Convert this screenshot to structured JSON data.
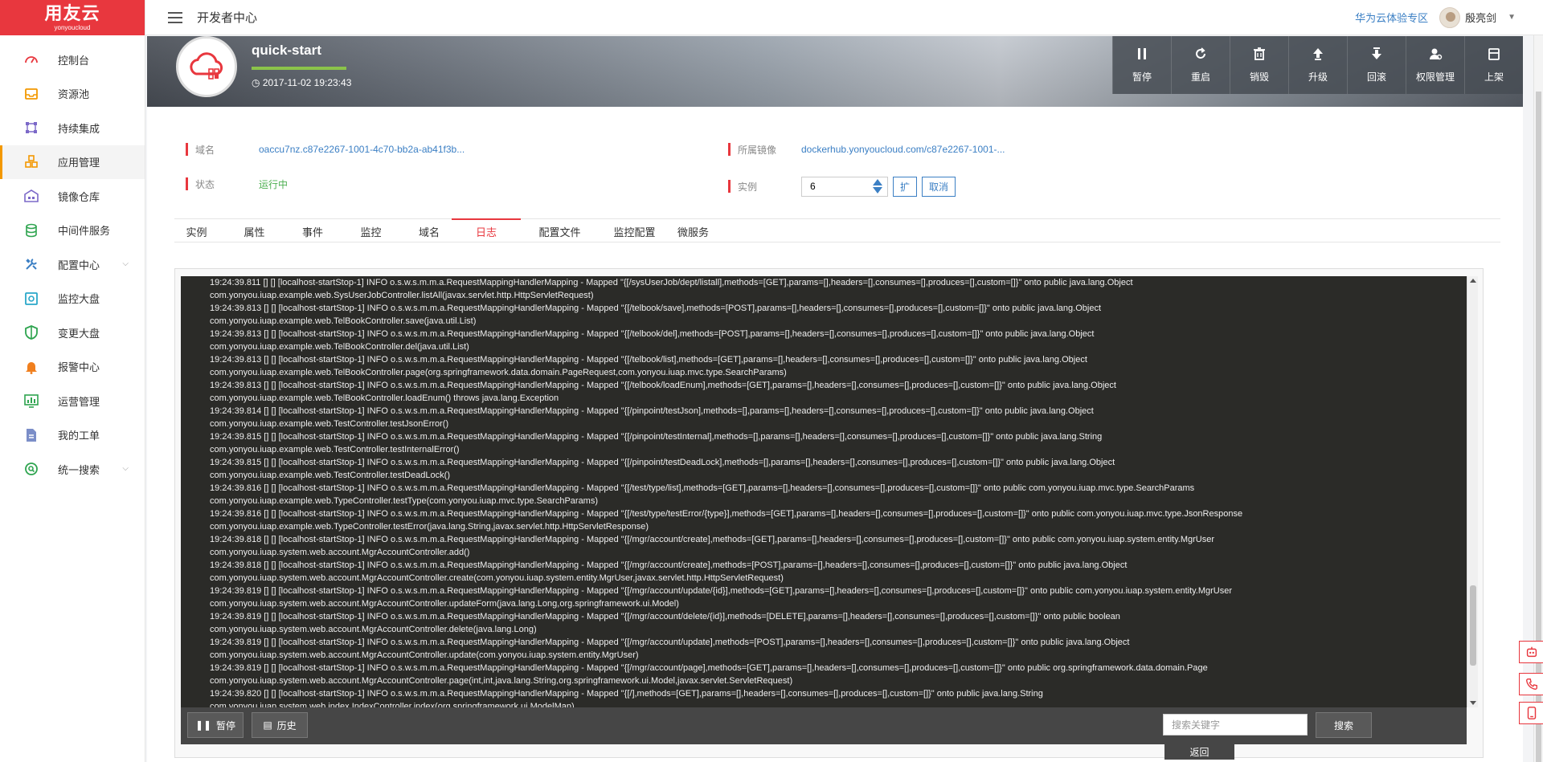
{
  "logo": {
    "main": "用友云",
    "sub": "yonyoucloud"
  },
  "sidebar": {
    "items": [
      {
        "label": "控制台",
        "icon": "dashboard-icon",
        "color": "#e8373e"
      },
      {
        "label": "资源池",
        "icon": "inbox-icon",
        "color": "#f39800"
      },
      {
        "label": "持续集成",
        "icon": "integration-icon",
        "color": "#7b68c8"
      },
      {
        "label": "应用管理",
        "icon": "cubes-icon",
        "color": "#f39800",
        "active": true
      },
      {
        "label": "镜像仓库",
        "icon": "warehouse-icon",
        "color": "#7b68c8"
      },
      {
        "label": "中间件服务",
        "icon": "database-icon",
        "color": "#2ea44f"
      },
      {
        "label": "配置中心",
        "icon": "tools-icon",
        "color": "#3b7fc4",
        "expandable": true
      },
      {
        "label": "监控大盘",
        "icon": "monitor-icon",
        "color": "#2aa7c9"
      },
      {
        "label": "变更大盘",
        "icon": "shield-icon",
        "color": "#2ea44f"
      },
      {
        "label": "报警中心",
        "icon": "bell-icon",
        "color": "#f07f1e"
      },
      {
        "label": "运营管理",
        "icon": "chart-icon",
        "color": "#2ea44f"
      },
      {
        "label": "我的工单",
        "icon": "document-icon",
        "color": "#7b8ec8"
      },
      {
        "label": "统一搜索",
        "icon": "search-icon",
        "color": "#2ea44f",
        "expandable": true
      }
    ]
  },
  "topbar": {
    "title": "开发者中心",
    "huawei_link": "华为云体验专区",
    "user": "殷亮剑"
  },
  "app": {
    "name": "quick-start",
    "time": "2017-11-02 19:23:43",
    "actions": [
      {
        "label": "暂停",
        "icon": "pause-icon"
      },
      {
        "label": "重启",
        "icon": "restart-icon"
      },
      {
        "label": "销毁",
        "icon": "trash-icon"
      },
      {
        "label": "升级",
        "icon": "upgrade-icon"
      },
      {
        "label": "回滚",
        "icon": "rollback-icon"
      },
      {
        "label": "权限管理",
        "icon": "user-permission-icon"
      },
      {
        "label": "上架",
        "icon": "shelf-icon"
      }
    ]
  },
  "info": {
    "domain_label": "域名",
    "domain_value": "oaccu7nz.c87e2267-1001-4c70-bb2a-ab41f3b...",
    "image_label": "所属镜像",
    "image_value": "dockerhub.yonyoucloud.com/c87e2267-1001-...",
    "status_label": "状态",
    "status_value": "运行中",
    "instance_label": "实例",
    "instance_value": "6",
    "expand_btn": "扩",
    "cancel_btn": "取消"
  },
  "tabs": [
    {
      "label": "实例"
    },
    {
      "label": "属性"
    },
    {
      "label": "事件"
    },
    {
      "label": "监控"
    },
    {
      "label": "域名"
    },
    {
      "label": "日志",
      "active": true
    },
    {
      "label": "配置文件"
    },
    {
      "label": "监控配置"
    },
    {
      "label": "微服务"
    }
  ],
  "log": {
    "lines": [
      "19:24:39.811 [] [] [localhost-startStop-1] INFO o.s.w.s.m.m.a.RequestMappingHandlerMapping - Mapped \"{[/sysUserJob/dept/listall],methods=[GET],params=[],headers=[],consumes=[],produces=[],custom=[]}\" onto public java.lang.Object",
      "com.yonyou.iuap.example.web.SysUserJobController.listAll(javax.servlet.http.HttpServletRequest)",
      "19:24:39.813 [] [] [localhost-startStop-1] INFO o.s.w.s.m.m.a.RequestMappingHandlerMapping - Mapped \"{[/telbook/save],methods=[POST],params=[],headers=[],consumes=[],produces=[],custom=[]}\" onto public java.lang.Object",
      "com.yonyou.iuap.example.web.TelBookController.save(java.util.List)",
      "19:24:39.813 [] [] [localhost-startStop-1] INFO o.s.w.s.m.m.a.RequestMappingHandlerMapping - Mapped \"{[/telbook/del],methods=[POST],params=[],headers=[],consumes=[],produces=[],custom=[]}\" onto public java.lang.Object",
      "com.yonyou.iuap.example.web.TelBookController.del(java.util.List)",
      "19:24:39.813 [] [] [localhost-startStop-1] INFO o.s.w.s.m.m.a.RequestMappingHandlerMapping - Mapped \"{[/telbook/list],methods=[GET],params=[],headers=[],consumes=[],produces=[],custom=[]}\" onto public java.lang.Object",
      "com.yonyou.iuap.example.web.TelBookController.page(org.springframework.data.domain.PageRequest,com.yonyou.iuap.mvc.type.SearchParams)",
      "19:24:39.813 [] [] [localhost-startStop-1] INFO o.s.w.s.m.m.a.RequestMappingHandlerMapping - Mapped \"{[/telbook/loadEnum],methods=[GET],params=[],headers=[],consumes=[],produces=[],custom=[]}\" onto public java.lang.Object",
      "com.yonyou.iuap.example.web.TelBookController.loadEnum() throws java.lang.Exception",
      "19:24:39.814 [] [] [localhost-startStop-1] INFO o.s.w.s.m.m.a.RequestMappingHandlerMapping - Mapped \"{[/pinpoint/testJson],methods=[],params=[],headers=[],consumes=[],produces=[],custom=[]}\" onto public java.lang.Object",
      "com.yonyou.iuap.example.web.TestController.testJsonError()",
      "19:24:39.815 [] [] [localhost-startStop-1] INFO o.s.w.s.m.m.a.RequestMappingHandlerMapping - Mapped \"{[/pinpoint/testInternal],methods=[],params=[],headers=[],consumes=[],produces=[],custom=[]}\" onto public java.lang.String",
      "com.yonyou.iuap.example.web.TestController.testInternalError()",
      "19:24:39.815 [] [] [localhost-startStop-1] INFO o.s.w.s.m.m.a.RequestMappingHandlerMapping - Mapped \"{[/pinpoint/testDeadLock],methods=[],params=[],headers=[],consumes=[],produces=[],custom=[]}\" onto public java.lang.Object",
      "com.yonyou.iuap.example.web.TestController.testDeadLock()",
      "19:24:39.816 [] [] [localhost-startStop-1] INFO o.s.w.s.m.m.a.RequestMappingHandlerMapping - Mapped \"{[/test/type/list],methods=[GET],params=[],headers=[],consumes=[],produces=[],custom=[]}\" onto public com.yonyou.iuap.mvc.type.SearchParams",
      "com.yonyou.iuap.example.web.TypeController.testType(com.yonyou.iuap.mvc.type.SearchParams)",
      "19:24:39.816 [] [] [localhost-startStop-1] INFO o.s.w.s.m.m.a.RequestMappingHandlerMapping - Mapped \"{[/test/type/testError/{type}],methods=[GET],params=[],headers=[],consumes=[],produces=[],custom=[]}\" onto public com.yonyou.iuap.mvc.type.JsonResponse",
      "com.yonyou.iuap.example.web.TypeController.testError(java.lang.String,javax.servlet.http.HttpServletResponse)",
      "19:24:39.818 [] [] [localhost-startStop-1] INFO o.s.w.s.m.m.a.RequestMappingHandlerMapping - Mapped \"{[/mgr/account/create],methods=[GET],params=[],headers=[],consumes=[],produces=[],custom=[]}\" onto public com.yonyou.iuap.system.entity.MgrUser",
      "com.yonyou.iuap.system.web.account.MgrAccountController.add()",
      "19:24:39.818 [] [] [localhost-startStop-1] INFO o.s.w.s.m.m.a.RequestMappingHandlerMapping - Mapped \"{[/mgr/account/create],methods=[POST],params=[],headers=[],consumes=[],produces=[],custom=[]}\" onto public java.lang.Object",
      "com.yonyou.iuap.system.web.account.MgrAccountController.create(com.yonyou.iuap.system.entity.MgrUser,javax.servlet.http.HttpServletRequest)",
      "19:24:39.819 [] [] [localhost-startStop-1] INFO o.s.w.s.m.m.a.RequestMappingHandlerMapping - Mapped \"{[/mgr/account/update/{id}],methods=[GET],params=[],headers=[],consumes=[],produces=[],custom=[]}\" onto public com.yonyou.iuap.system.entity.MgrUser",
      "com.yonyou.iuap.system.web.account.MgrAccountController.updateForm(java.lang.Long,org.springframework.ui.Model)",
      "19:24:39.819 [] [] [localhost-startStop-1] INFO o.s.w.s.m.m.a.RequestMappingHandlerMapping - Mapped \"{[/mgr/account/delete/{id}],methods=[DELETE],params=[],headers=[],consumes=[],produces=[],custom=[]}\" onto public boolean",
      "com.yonyou.iuap.system.web.account.MgrAccountController.delete(java.lang.Long)",
      "19:24:39.819 [] [] [localhost-startStop-1] INFO o.s.w.s.m.m.a.RequestMappingHandlerMapping - Mapped \"{[/mgr/account/update],methods=[POST],params=[],headers=[],consumes=[],produces=[],custom=[]}\" onto public java.lang.Object",
      "com.yonyou.iuap.system.web.account.MgrAccountController.update(com.yonyou.iuap.system.entity.MgrUser)",
      "19:24:39.819 [] [] [localhost-startStop-1] INFO o.s.w.s.m.m.a.RequestMappingHandlerMapping - Mapped \"{[/mgr/account/page],methods=[GET],params=[],headers=[],consumes=[],produces=[],custom=[]}\" onto public org.springframework.data.domain.Page",
      "com.yonyou.iuap.system.web.account.MgrAccountController.page(int,int,java.lang.String,org.springframework.ui.Model,javax.servlet.ServletRequest)",
      "19:24:39.820 [] [] [localhost-startStop-1] INFO o.s.w.s.m.m.a.RequestMappingHandlerMapping - Mapped \"{[/],methods=[GET],params=[],headers=[],consumes=[],produces=[],custom=[]}\" onto public java.lang.String",
      "com.yonyou.iuap.system.web.index.IndexController.index(org.springframework.ui.ModelMap)"
    ],
    "pause_btn": "暂停",
    "history_btn": "历史",
    "search_placeholder": "搜索关键字",
    "search_btn": "搜索",
    "back_btn": "返回"
  },
  "floating": [
    {
      "icon": "robot-icon"
    },
    {
      "icon": "phone-icon"
    },
    {
      "icon": "mobile-icon"
    }
  ],
  "colors": {
    "brand": "#e8373e",
    "accent": "#f39800",
    "link": "#3b7fc4",
    "running": "#4caf50",
    "log_bg": "#2b2b28"
  }
}
